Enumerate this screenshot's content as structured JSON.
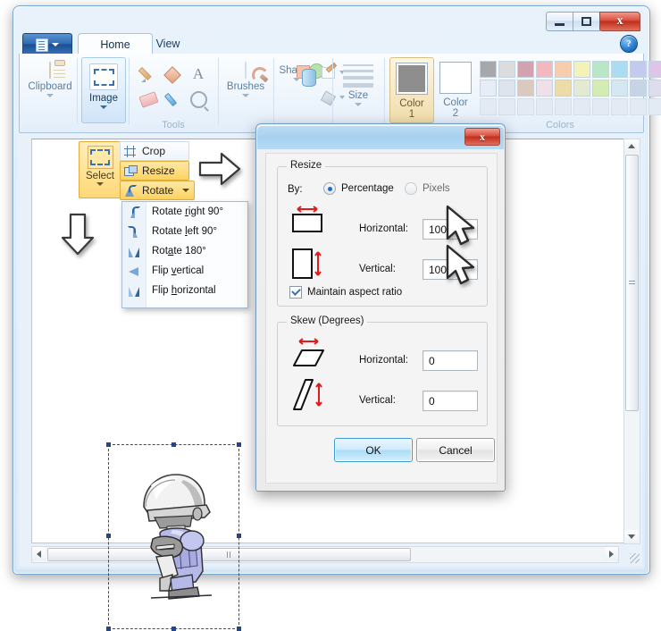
{
  "window": {
    "title": "",
    "buttons": {
      "minimize": "–",
      "maximize": "□",
      "close": "x"
    }
  },
  "ribbon": {
    "paint_button": {
      "label": "",
      "icon": "paint-menu-icon"
    },
    "tabs": [
      {
        "id": "home",
        "label": "Home",
        "active": true
      },
      {
        "id": "view",
        "label": "View",
        "active": false
      }
    ],
    "help": {
      "label": "?",
      "icon": "help-icon"
    },
    "groups": [
      {
        "id": "clipboard",
        "label": "Clipboard",
        "button": "Clipboard"
      },
      {
        "id": "image",
        "label": "Image",
        "button": "Image"
      },
      {
        "id": "tools",
        "label": "Tools"
      },
      {
        "id": "brushes",
        "label": "Brushes",
        "button": "Brushes"
      },
      {
        "id": "shapes",
        "label": "Shapes",
        "button": "Shapes"
      },
      {
        "id": "size",
        "label": "Size",
        "button": "Size"
      },
      {
        "id": "colors",
        "label": "Colors"
      }
    ],
    "color1": {
      "label_top": "Color",
      "label_bottom": "1",
      "value": "#8e8e8e"
    },
    "color2": {
      "label_top": "Color",
      "label_bottom": "2",
      "value": "#ffffff"
    },
    "palette_rows": [
      [
        "#a6a8ab",
        "#dcdcdc",
        "#d2a3ae",
        "#f3b8bd",
        "#f7cdae",
        "#f4f3b5",
        "#b9e6c4",
        "#aadcf2",
        "#c4c9ee",
        "#dfc4e8"
      ],
      [
        "#e6edf6",
        "#dde4ee",
        "#d9c9c0",
        "#efdfe9",
        "#ecdcaa",
        "#e4e9d2",
        "#d3ecb4",
        "#d5e8f2",
        "#c6d4e6",
        "#ddddee"
      ],
      [
        "#e3eaf4",
        "#e3eaf4",
        "#e3eaf4",
        "#e3eaf4",
        "#e3eaf4",
        "#e3eaf4",
        "#e3eaf4",
        "#e3eaf4",
        "#e3eaf4",
        "#e3eaf4"
      ]
    ]
  },
  "image_flyout": {
    "select_button": "Select",
    "items": [
      {
        "id": "crop",
        "label": "Crop",
        "highlighted": false
      },
      {
        "id": "resize",
        "label": "Resize",
        "highlighted": true
      },
      {
        "id": "rotate",
        "label": "Rotate",
        "highlighted": true
      }
    ]
  },
  "rotate_menu": {
    "items": [
      {
        "id": "rotate-right-90",
        "pre": "Rotate ",
        "key": "r",
        "post": "ight 90°"
      },
      {
        "id": "rotate-left-90",
        "pre": "Rotate ",
        "key": "l",
        "post": "eft 90°"
      },
      {
        "id": "rotate-180",
        "pre": "Rot",
        "key": "a",
        "post": "te 180°"
      },
      {
        "id": "flip-vertical",
        "pre": "Flip ",
        "key": "v",
        "post": "ertical"
      },
      {
        "id": "flip-horizontal",
        "pre": "Flip ",
        "key": "h",
        "post": "orizontal"
      }
    ]
  },
  "dialog": {
    "title": "",
    "close_label": "x",
    "resize_group": {
      "legend": "Resize",
      "by_label": "By:",
      "options": [
        {
          "id": "percentage",
          "label": "Percentage",
          "selected": true
        },
        {
          "id": "pixels",
          "label": "Pixels",
          "selected": false
        }
      ],
      "horizontal_label": "Horizontal:",
      "horizontal_value": "100",
      "vertical_label": "Vertical:",
      "vertical_value": "100",
      "maintain_label": "Maintain aspect ratio",
      "maintain_checked": true
    },
    "skew_group": {
      "legend": "Skew (Degrees)",
      "horizontal_label": "Horizontal:",
      "horizontal_value": "0",
      "vertical_label": "Vertical:",
      "vertical_value": "0"
    },
    "ok_label": "OK",
    "cancel_label": "Cancel"
  },
  "canvas": {
    "selection": {
      "active": true
    },
    "artwork_name": "pixel-art-soldier"
  },
  "accent": {
    "blue": "#1c6fc4",
    "red": "#c22f1c",
    "highlight_yellow": "#ffd25e"
  }
}
